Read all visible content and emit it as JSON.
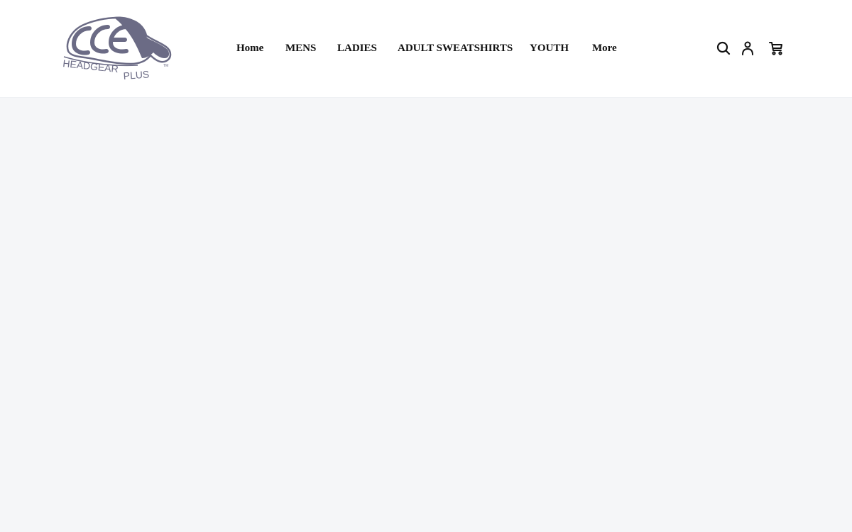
{
  "brand": {
    "logo_name": "CCE HEADGEAR PLUS",
    "logo_color": "#6b6b85"
  },
  "nav": {
    "items": [
      {
        "label": "Home"
      },
      {
        "label": "MENS"
      },
      {
        "label": "LADIES"
      },
      {
        "label": "ADULT SWEATSHIRTS"
      },
      {
        "label": "YOUTH"
      },
      {
        "label": "More"
      }
    ]
  },
  "header_icons": {
    "search": "search-icon",
    "account": "user-icon",
    "cart": "cart-icon"
  },
  "colors": {
    "header_bg": "#ffffff",
    "page_bg": "#f5f6f8",
    "nav_text": "#111111"
  }
}
